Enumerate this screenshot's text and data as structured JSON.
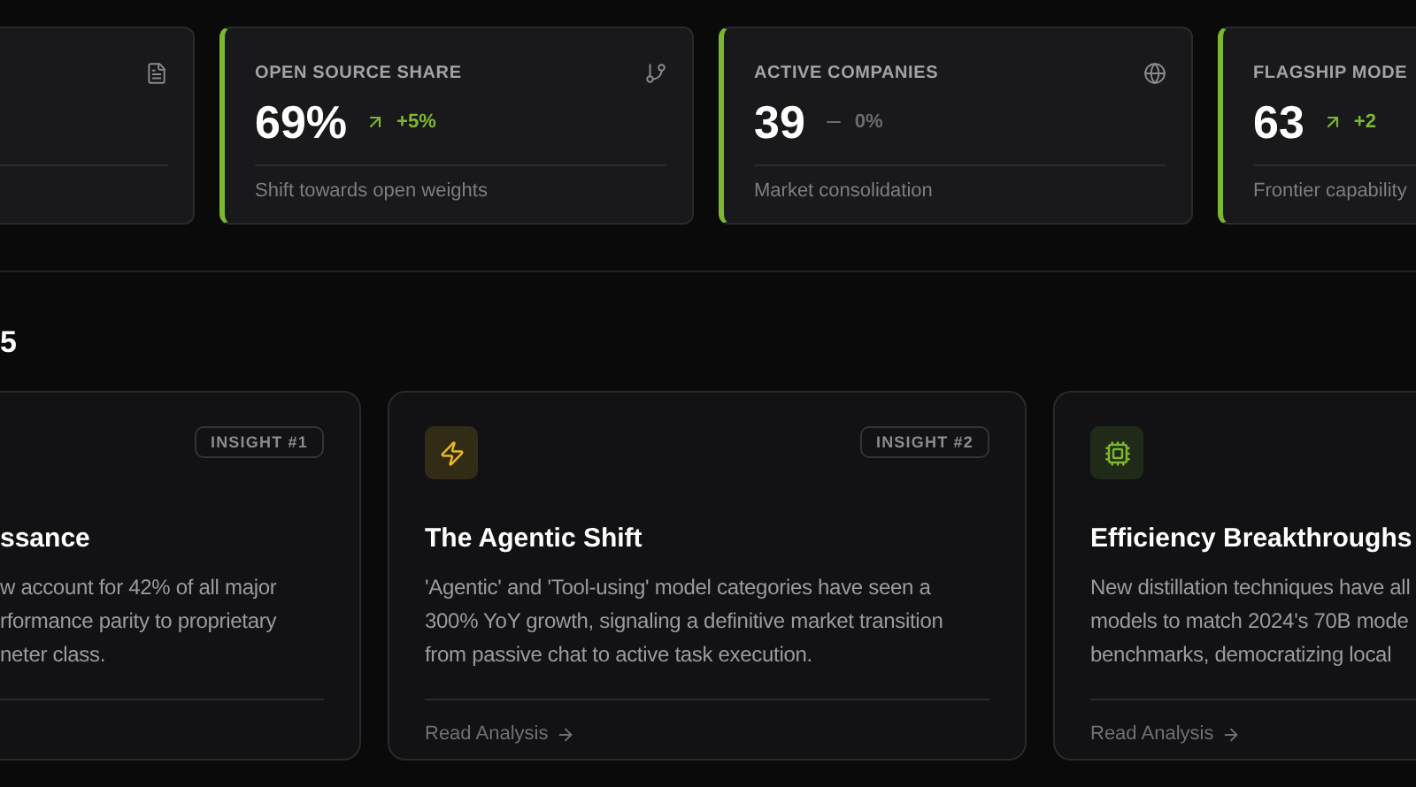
{
  "stats": [
    {
      "kind": "blank"
    },
    {
      "accent": true,
      "label": "OPEN SOURCE SHARE",
      "value": "69%",
      "kind": "up",
      "change": "+5%",
      "note": "Shift towards open weights"
    },
    {
      "accent": true,
      "label": "ACTIVE COMPANIES",
      "value": "39",
      "kind": "flat",
      "change": "0%",
      "note": "Market consolidation"
    },
    {
      "accent": true,
      "label": "FLAGSHIP MODE",
      "value": "63",
      "kind": "up",
      "change": "+2",
      "note": "Frontier capability"
    }
  ],
  "section": {
    "title": "5"
  },
  "insights": [
    {
      "badge": "INSIGHT #1",
      "title": "ssance",
      "lines": [
        "w account for 42% of all major",
        "rformance parity to proprietary",
        "neter class."
      ]
    },
    {
      "kind": "bolt",
      "color": "#e8b923",
      "badge": "INSIGHT #2",
      "title": "The Agentic Shift",
      "lines": [
        "'Agentic' and 'Tool-using' model categories have seen a",
        "300% YoY growth, signaling a definitive market transition",
        "from passive chat to active task execution."
      ],
      "link": "Read Analysis"
    },
    {
      "kind": "chip",
      "color": "#7cb82f",
      "title": "Efficiency Breakthroughs",
      "lines": [
        "New distillation techniques have all",
        "models to match 2024's 70B mode",
        "benchmarks, democratizing local"
      ],
      "link": "Read Analysis"
    }
  ]
}
